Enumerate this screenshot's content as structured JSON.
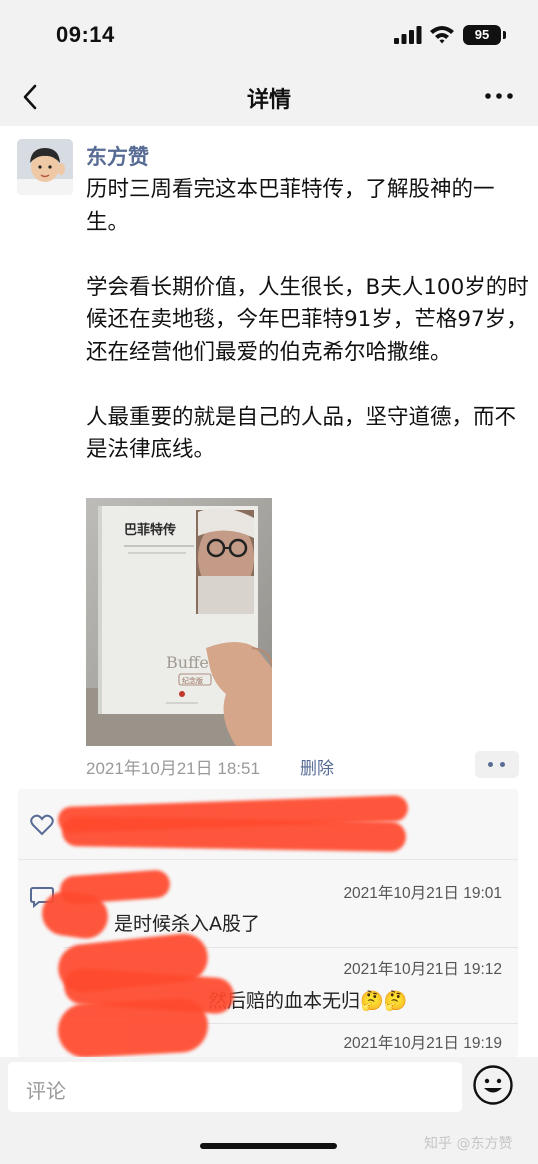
{
  "status_bar": {
    "time": "09:14",
    "battery": "95"
  },
  "nav": {
    "title": "详情",
    "back_icon": "chevron-left-icon",
    "more_icon": "ellipsis-icon"
  },
  "post": {
    "author": "东方赞",
    "paragraphs": [
      "历时三周看完这本巴菲特传，了解股神的一生。",
      "学会看长期价值，人生很长，B夫人100岁的时候还在卖地毯，今年巴菲特91岁，芒格97岁，还在经营他们最爱的伯克希尔哈撒维。",
      "人最重要的就是自己的人品，坚守道德，而不是法律底线。"
    ],
    "photo": {
      "book_title": "巴菲特传",
      "book_subtitle": "Buffett",
      "book_edition": "纪念版"
    },
    "timestamp": "2021年10月21日 18:51",
    "delete_label": "删除"
  },
  "comments": [
    {
      "time": "2021年10月21日 19:01",
      "text_visible": "是时候杀入A股了"
    },
    {
      "time": "2021年10月21日 19:12",
      "text_visible": "然后赔的血本无归🤔🤔"
    },
    {
      "time": "2021年10月21日 19:19",
      "text_visible": ""
    }
  ],
  "input": {
    "placeholder": "评论"
  },
  "watermark": "知乎 @东方赞",
  "colors": {
    "link_blue": "#576b95",
    "redaction": "#ff4a2e",
    "bar_gray": "#f2f2f2"
  }
}
